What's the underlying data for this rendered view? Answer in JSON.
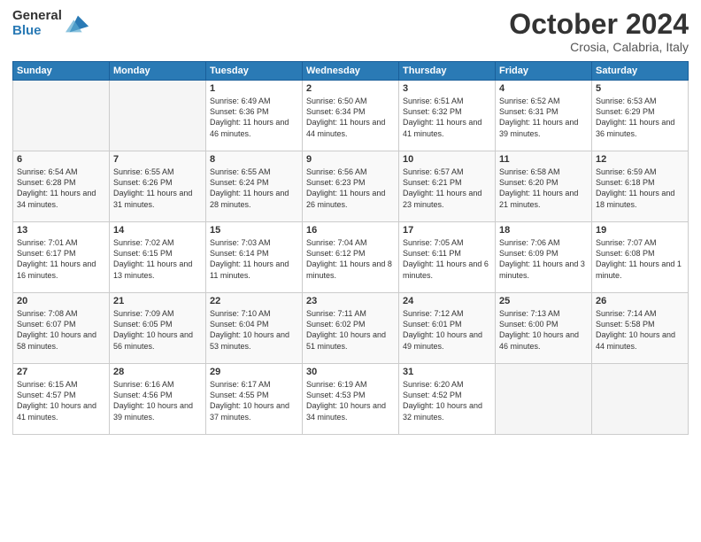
{
  "header": {
    "logo_general": "General",
    "logo_blue": "Blue",
    "month_title": "October 2024",
    "location": "Crosia, Calabria, Italy"
  },
  "weekdays": [
    "Sunday",
    "Monday",
    "Tuesday",
    "Wednesday",
    "Thursday",
    "Friday",
    "Saturday"
  ],
  "weeks": [
    [
      {
        "day": "",
        "empty": true
      },
      {
        "day": "",
        "empty": true
      },
      {
        "day": "1",
        "sunrise": "6:49 AM",
        "sunset": "6:36 PM",
        "daylight": "11 hours and 46 minutes."
      },
      {
        "day": "2",
        "sunrise": "6:50 AM",
        "sunset": "6:34 PM",
        "daylight": "11 hours and 44 minutes."
      },
      {
        "day": "3",
        "sunrise": "6:51 AM",
        "sunset": "6:32 PM",
        "daylight": "11 hours and 41 minutes."
      },
      {
        "day": "4",
        "sunrise": "6:52 AM",
        "sunset": "6:31 PM",
        "daylight": "11 hours and 39 minutes."
      },
      {
        "day": "5",
        "sunrise": "6:53 AM",
        "sunset": "6:29 PM",
        "daylight": "11 hours and 36 minutes."
      }
    ],
    [
      {
        "day": "6",
        "sunrise": "6:54 AM",
        "sunset": "6:28 PM",
        "daylight": "11 hours and 34 minutes."
      },
      {
        "day": "7",
        "sunrise": "6:55 AM",
        "sunset": "6:26 PM",
        "daylight": "11 hours and 31 minutes."
      },
      {
        "day": "8",
        "sunrise": "6:55 AM",
        "sunset": "6:24 PM",
        "daylight": "11 hours and 28 minutes."
      },
      {
        "day": "9",
        "sunrise": "6:56 AM",
        "sunset": "6:23 PM",
        "daylight": "11 hours and 26 minutes."
      },
      {
        "day": "10",
        "sunrise": "6:57 AM",
        "sunset": "6:21 PM",
        "daylight": "11 hours and 23 minutes."
      },
      {
        "day": "11",
        "sunrise": "6:58 AM",
        "sunset": "6:20 PM",
        "daylight": "11 hours and 21 minutes."
      },
      {
        "day": "12",
        "sunrise": "6:59 AM",
        "sunset": "6:18 PM",
        "daylight": "11 hours and 18 minutes."
      }
    ],
    [
      {
        "day": "13",
        "sunrise": "7:01 AM",
        "sunset": "6:17 PM",
        "daylight": "11 hours and 16 minutes."
      },
      {
        "day": "14",
        "sunrise": "7:02 AM",
        "sunset": "6:15 PM",
        "daylight": "11 hours and 13 minutes."
      },
      {
        "day": "15",
        "sunrise": "7:03 AM",
        "sunset": "6:14 PM",
        "daylight": "11 hours and 11 minutes."
      },
      {
        "day": "16",
        "sunrise": "7:04 AM",
        "sunset": "6:12 PM",
        "daylight": "11 hours and 8 minutes."
      },
      {
        "day": "17",
        "sunrise": "7:05 AM",
        "sunset": "6:11 PM",
        "daylight": "11 hours and 6 minutes."
      },
      {
        "day": "18",
        "sunrise": "7:06 AM",
        "sunset": "6:09 PM",
        "daylight": "11 hours and 3 minutes."
      },
      {
        "day": "19",
        "sunrise": "7:07 AM",
        "sunset": "6:08 PM",
        "daylight": "11 hours and 1 minute."
      }
    ],
    [
      {
        "day": "20",
        "sunrise": "7:08 AM",
        "sunset": "6:07 PM",
        "daylight": "10 hours and 58 minutes."
      },
      {
        "day": "21",
        "sunrise": "7:09 AM",
        "sunset": "6:05 PM",
        "daylight": "10 hours and 56 minutes."
      },
      {
        "day": "22",
        "sunrise": "7:10 AM",
        "sunset": "6:04 PM",
        "daylight": "10 hours and 53 minutes."
      },
      {
        "day": "23",
        "sunrise": "7:11 AM",
        "sunset": "6:02 PM",
        "daylight": "10 hours and 51 minutes."
      },
      {
        "day": "24",
        "sunrise": "7:12 AM",
        "sunset": "6:01 PM",
        "daylight": "10 hours and 49 minutes."
      },
      {
        "day": "25",
        "sunrise": "7:13 AM",
        "sunset": "6:00 PM",
        "daylight": "10 hours and 46 minutes."
      },
      {
        "day": "26",
        "sunrise": "7:14 AM",
        "sunset": "5:58 PM",
        "daylight": "10 hours and 44 minutes."
      }
    ],
    [
      {
        "day": "27",
        "sunrise": "6:15 AM",
        "sunset": "4:57 PM",
        "daylight": "10 hours and 41 minutes."
      },
      {
        "day": "28",
        "sunrise": "6:16 AM",
        "sunset": "4:56 PM",
        "daylight": "10 hours and 39 minutes."
      },
      {
        "day": "29",
        "sunrise": "6:17 AM",
        "sunset": "4:55 PM",
        "daylight": "10 hours and 37 minutes."
      },
      {
        "day": "30",
        "sunrise": "6:19 AM",
        "sunset": "4:53 PM",
        "daylight": "10 hours and 34 minutes."
      },
      {
        "day": "31",
        "sunrise": "6:20 AM",
        "sunset": "4:52 PM",
        "daylight": "10 hours and 32 minutes."
      },
      {
        "day": "",
        "empty": true
      },
      {
        "day": "",
        "empty": true
      }
    ]
  ]
}
